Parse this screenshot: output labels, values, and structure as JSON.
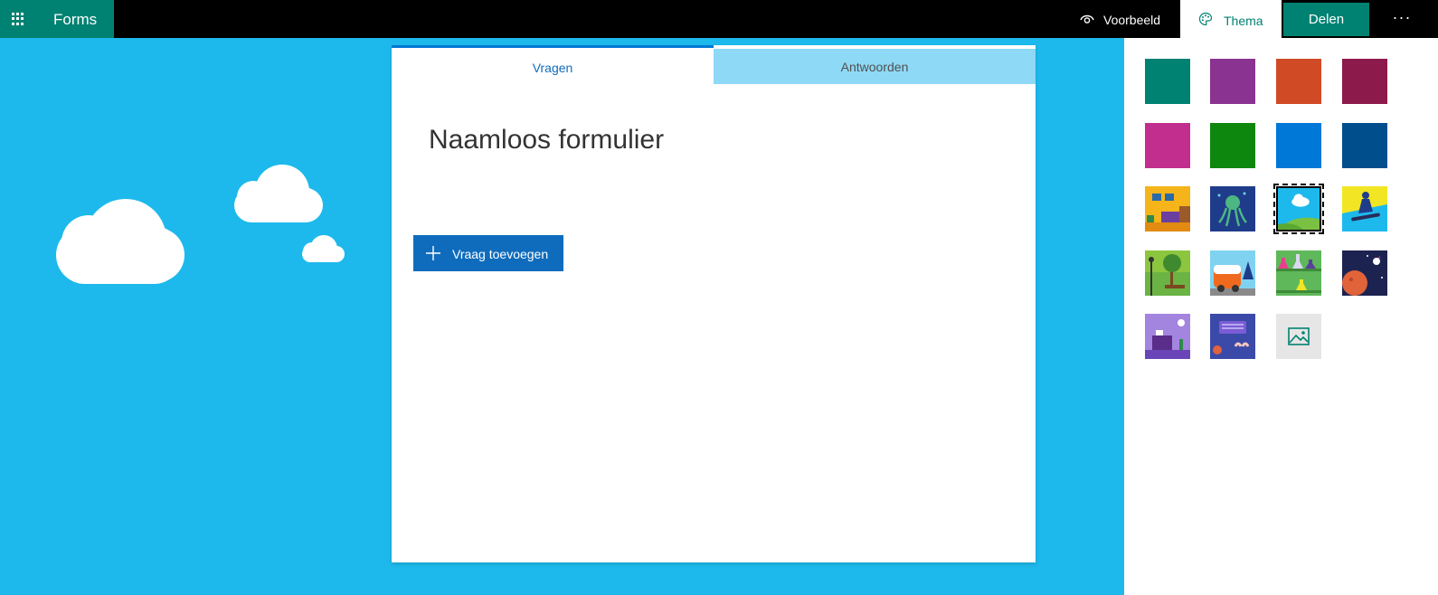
{
  "app": {
    "name": "Forms"
  },
  "toolbar": {
    "preview_label": "Voorbeeld",
    "theme_label": "Thema",
    "share_label": "Delen",
    "more_label": "···"
  },
  "form": {
    "tabs": [
      {
        "label": "Vragen",
        "active": true
      },
      {
        "label": "Antwoorden",
        "active": false
      }
    ],
    "title": "Naamloos formulier",
    "add_question_label": "Vraag toevoegen"
  },
  "theme_panel": {
    "colors": [
      "#008272",
      "#8a3391",
      "#d04a26",
      "#8c1a4a",
      "#c22e8d",
      "#0e870e",
      "#0078d7",
      "#004e8c"
    ],
    "images": [
      {
        "name": "living-room-theme",
        "selected": false
      },
      {
        "name": "octopus-theme",
        "selected": false
      },
      {
        "name": "sky-clouds-theme",
        "selected": true
      },
      {
        "name": "snowboarder-theme",
        "selected": false
      },
      {
        "name": "park-theme",
        "selected": false
      },
      {
        "name": "camper-van-theme",
        "selected": false
      },
      {
        "name": "science-flasks-theme",
        "selected": false
      },
      {
        "name": "space-rocket-theme",
        "selected": false
      },
      {
        "name": "desk-theme",
        "selected": false
      },
      {
        "name": "keyboard-theme",
        "selected": false
      },
      {
        "name": "upload-image",
        "selected": false
      }
    ]
  },
  "background": {
    "color": "#1db9ec"
  }
}
